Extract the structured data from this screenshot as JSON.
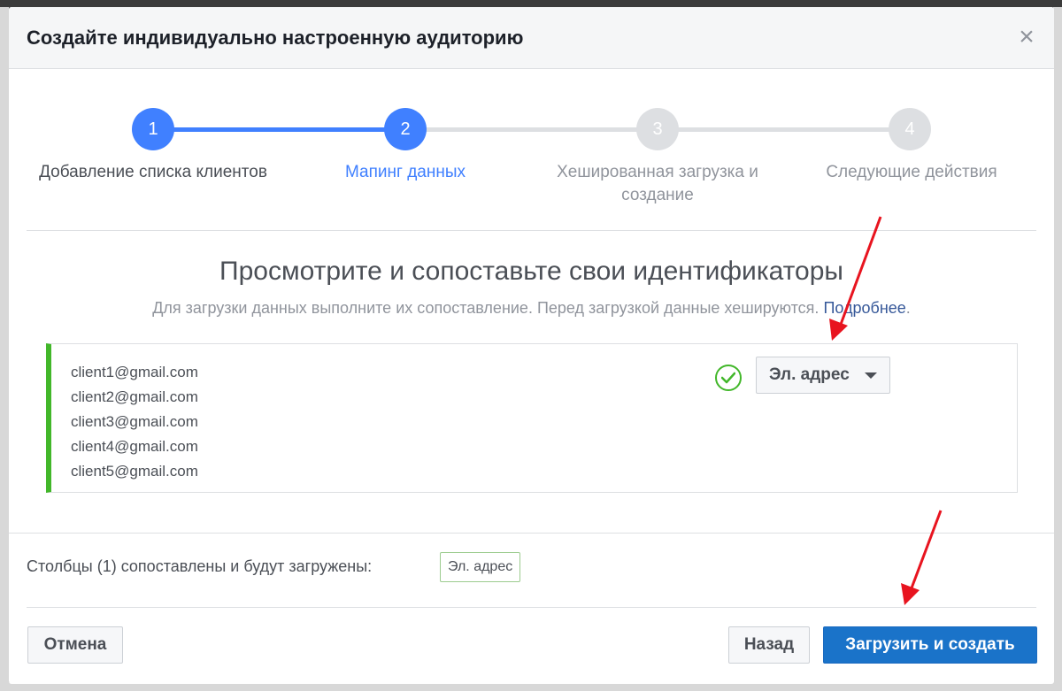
{
  "modal": {
    "title": "Создайте индивидуально настроенную аудиторию",
    "close_label": "×"
  },
  "stepper": {
    "steps": [
      {
        "number": "1",
        "label": "Добавление списка клиентов",
        "state": "completed"
      },
      {
        "number": "2",
        "label": "Мапинг данных",
        "state": "current"
      },
      {
        "number": "3",
        "label_line1": "Хешированная загрузка и",
        "label_line2": "создание",
        "state": "upcoming"
      },
      {
        "number": "4",
        "label": "Следующие действия",
        "state": "upcoming"
      }
    ]
  },
  "mapping": {
    "title": "Просмотрите и сопоставьте свои идентификаторы",
    "subtitle": "Для загрузки данных выполните их сопоставление. Перед загрузкой данные хешируются.",
    "learn_more": "Подробнее",
    "subtitle_end": ".",
    "emails": [
      "client1@gmail.com",
      "client2@gmail.com",
      "client3@gmail.com",
      "client4@gmail.com",
      "client5@gmail.com"
    ],
    "field_type": "Эл. адрес",
    "status_icon": "check-circle-icon"
  },
  "footer": {
    "mapped_text": "Столбцы (1) сопоставлены и будут загружены:",
    "mapped_badge": "Эл. адрес",
    "cancel_label": "Отмена",
    "back_label": "Назад",
    "submit_label": "Загрузить и создать"
  },
  "colors": {
    "accent": "#4080ff",
    "primary_button": "#1a73c9",
    "success": "#42b72a",
    "annotation_arrow": "#e8141f"
  }
}
